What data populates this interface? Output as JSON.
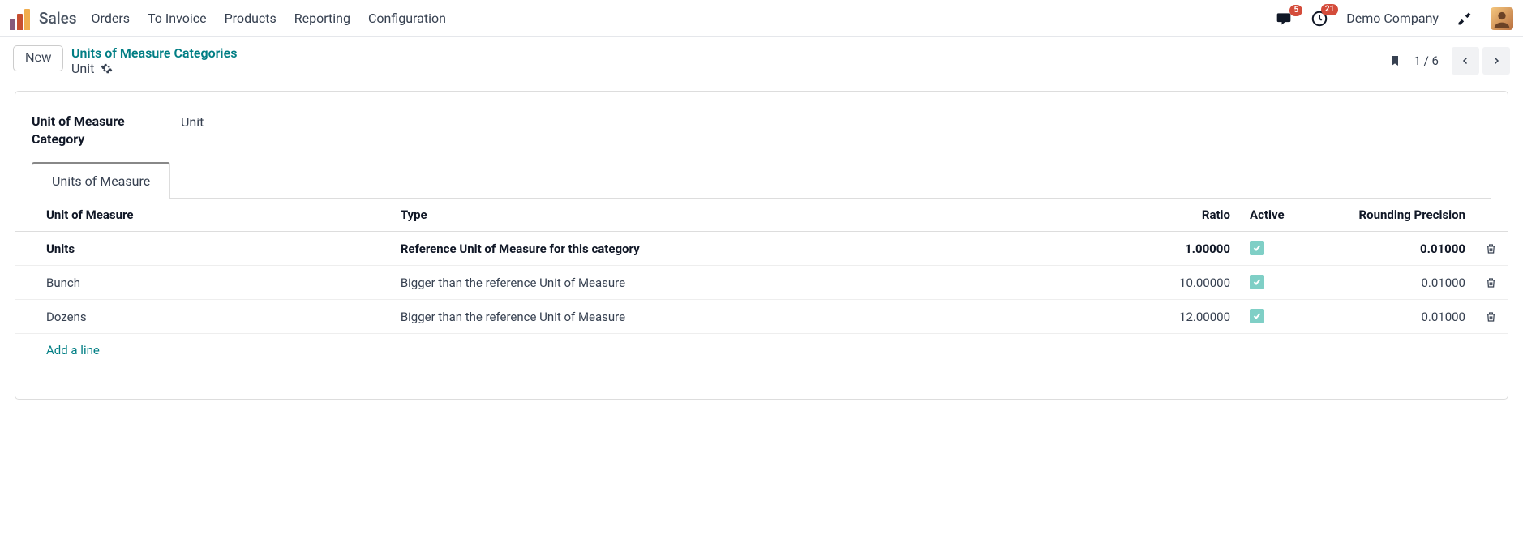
{
  "app": {
    "name": "Sales"
  },
  "nav": {
    "menu": [
      "Orders",
      "To Invoice",
      "Products",
      "Reporting",
      "Configuration"
    ],
    "messages_badge": "5",
    "activities_badge": "21",
    "company": "Demo Company"
  },
  "control": {
    "new_label": "New",
    "breadcrumb_parent": "Units of Measure Categories",
    "breadcrumb_current": "Unit",
    "pager": "1 / 6"
  },
  "form": {
    "category_label": "Unit of Measure Category",
    "category_value": "Unit",
    "tab_label": "Units of Measure"
  },
  "table": {
    "headers": {
      "uom": "Unit of Measure",
      "type": "Type",
      "ratio": "Ratio",
      "active": "Active",
      "rounding": "Rounding Precision"
    },
    "rows": [
      {
        "uom": "Units",
        "type": "Reference Unit of Measure for this category",
        "ratio": "1.00000",
        "active": true,
        "rounding": "0.01000",
        "is_ref": true
      },
      {
        "uom": "Bunch",
        "type": "Bigger than the reference Unit of Measure",
        "ratio": "10.00000",
        "active": true,
        "rounding": "0.01000",
        "is_ref": false
      },
      {
        "uom": "Dozens",
        "type": "Bigger than the reference Unit of Measure",
        "ratio": "12.00000",
        "active": true,
        "rounding": "0.01000",
        "is_ref": false
      }
    ],
    "add_line": "Add a line"
  }
}
